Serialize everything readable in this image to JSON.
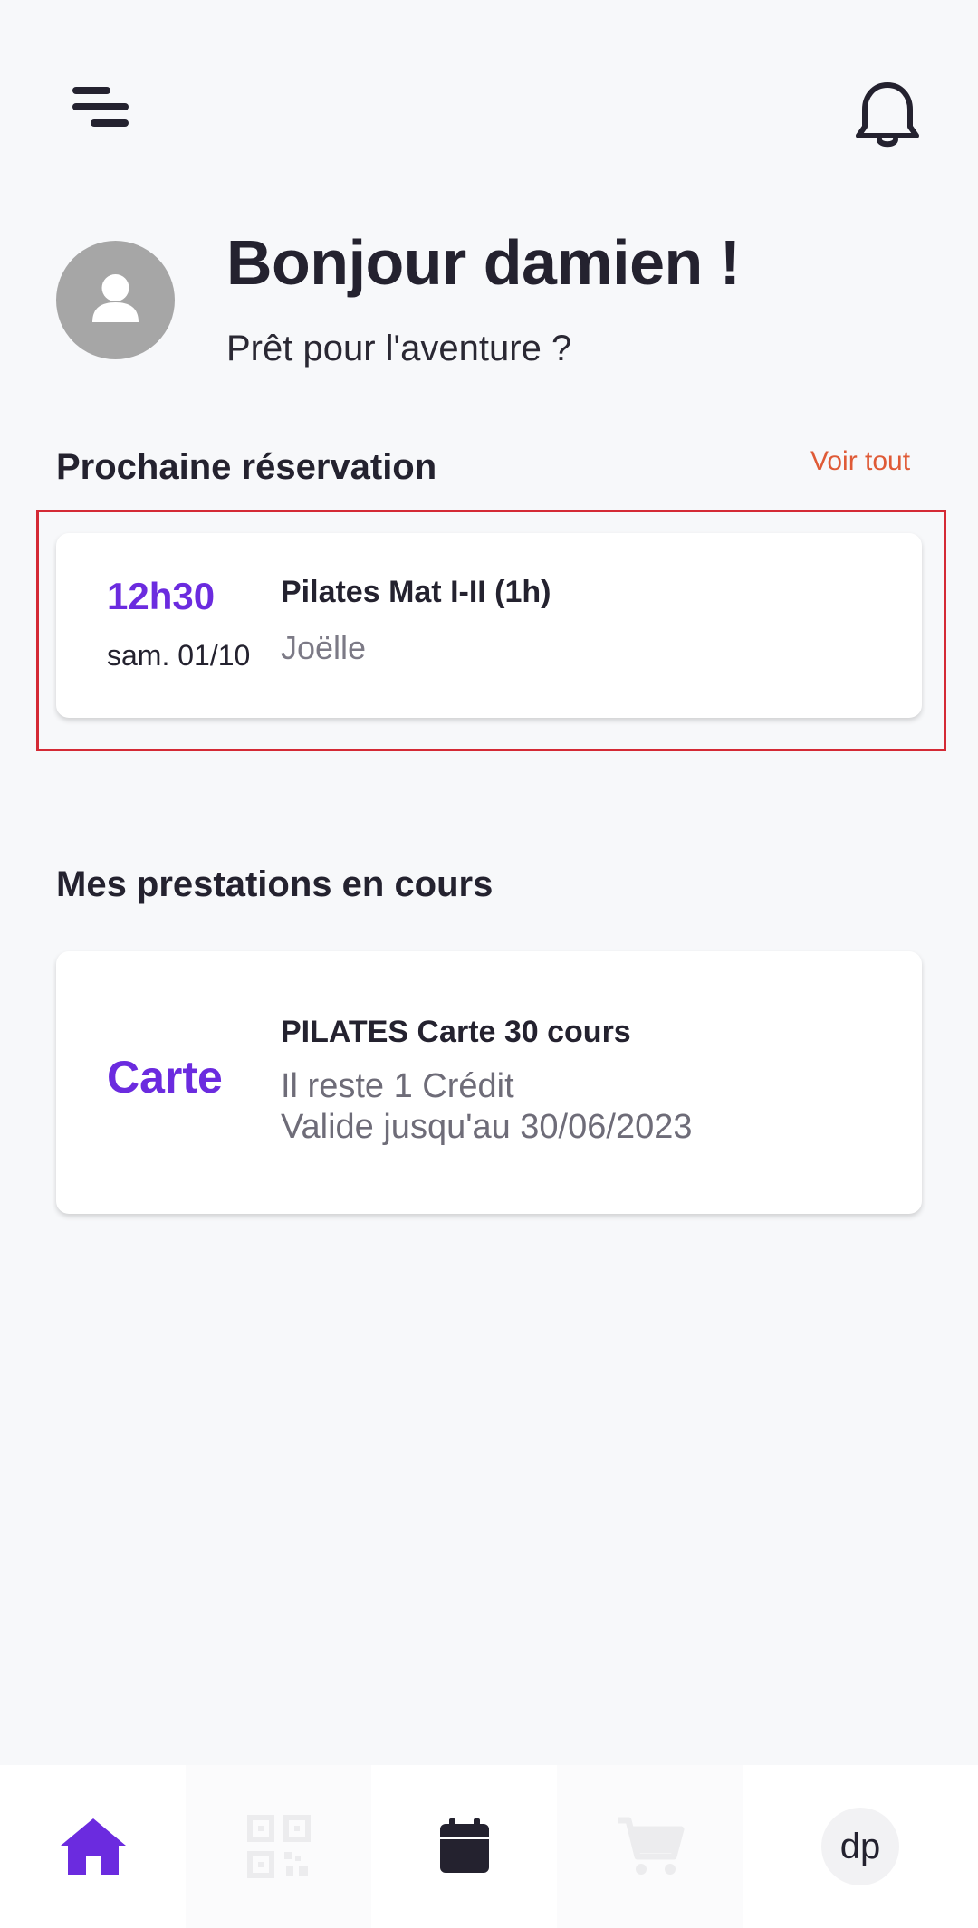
{
  "header": {
    "menu_icon": "menu-icon",
    "notification_icon": "bell-icon"
  },
  "greeting": {
    "title": "Bonjour damien !",
    "subtitle": "Prêt pour l'aventure ?",
    "avatar_icon": "user-icon"
  },
  "next_booking": {
    "section_title": "Prochaine réservation",
    "see_all_label": "Voir tout",
    "time": "12h30",
    "date": "sam. 01/10",
    "class_name": "Pilates Mat I-II (1h)",
    "teacher": "Joëlle"
  },
  "services": {
    "section_title": "Mes prestations en cours",
    "items": [
      {
        "kind": "Carte",
        "title": "PILATES Carte 30 cours",
        "remaining": "Il reste 1 Crédit",
        "validity": "Valide jusqu'au 30/06/2023"
      }
    ]
  },
  "bottom_nav": {
    "items": [
      {
        "icon": "home-icon",
        "active": true
      },
      {
        "icon": "qr-code-icon",
        "active": false
      },
      {
        "icon": "calendar-icon",
        "active": false
      },
      {
        "icon": "cart-icon",
        "active": false
      },
      {
        "icon": "profile-avatar",
        "label": "dp",
        "active": false
      }
    ]
  },
  "colors": {
    "accent": "#6b2bdf",
    "link": "#df5a36",
    "text": "#24222f",
    "background": "#f7f8fa",
    "highlight_border": "#d42a35"
  }
}
